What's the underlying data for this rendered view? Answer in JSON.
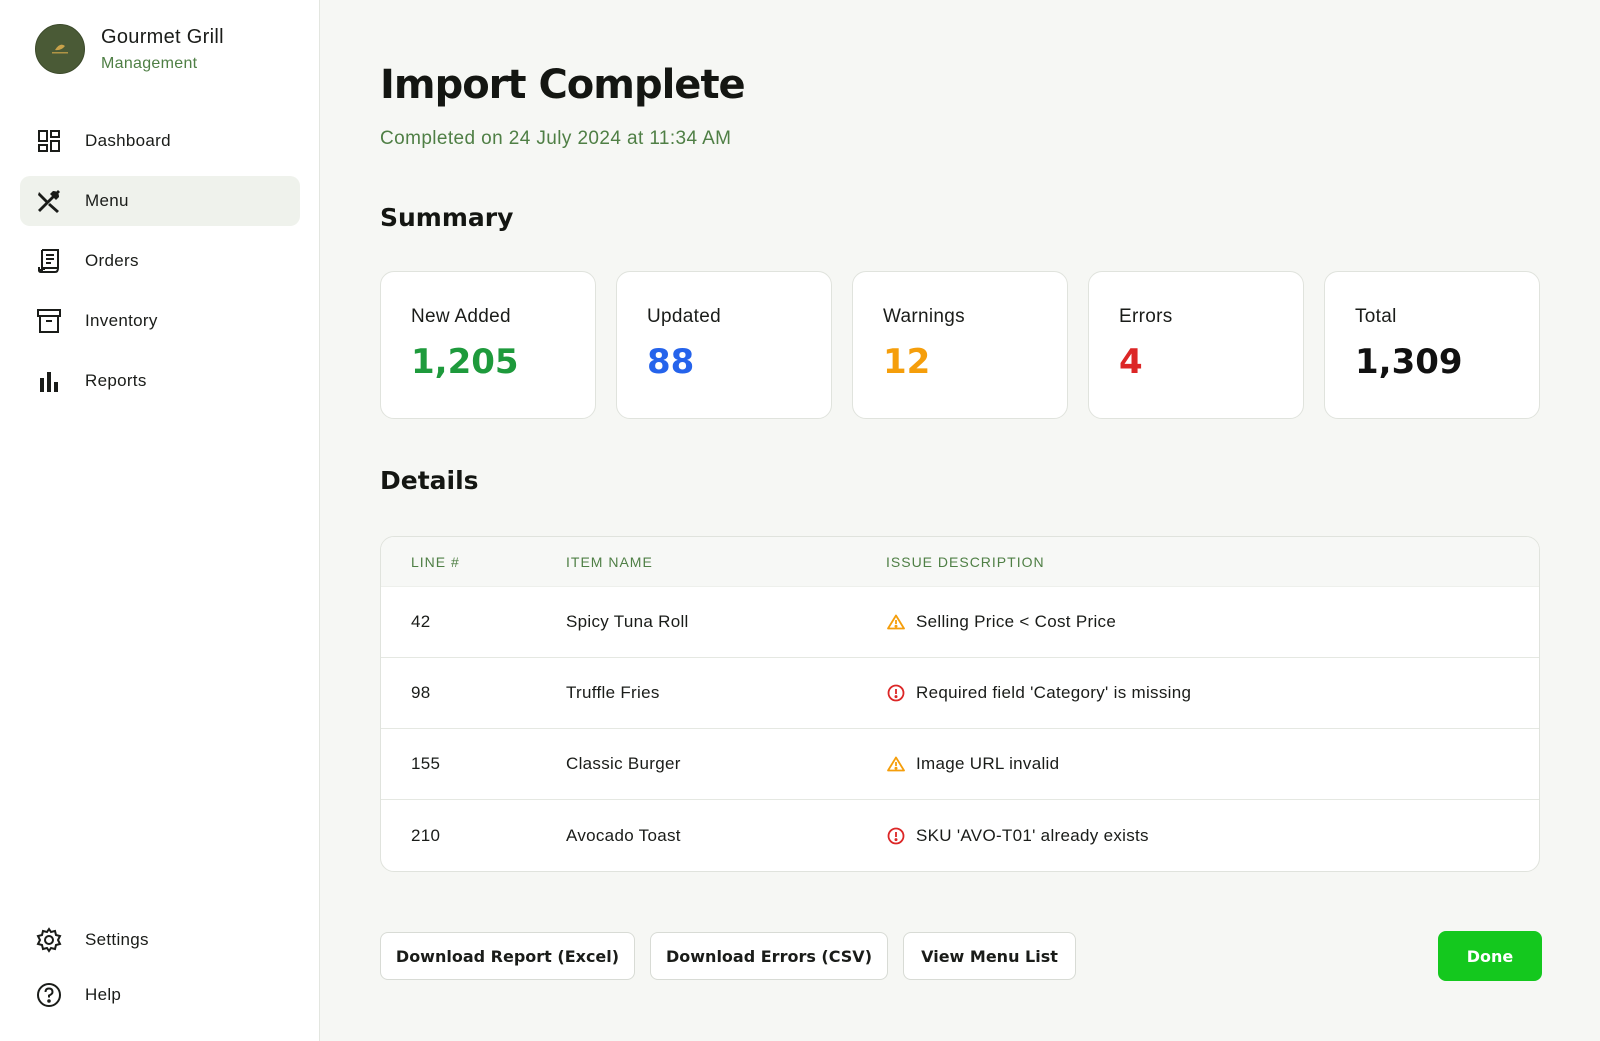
{
  "brand": {
    "name": "Gourmet Grill",
    "subtitle": "Management",
    "logo_text": "GOURMET GRILL"
  },
  "nav": {
    "items": [
      {
        "label": "Dashboard",
        "icon": "dashboard-icon"
      },
      {
        "label": "Menu",
        "icon": "utensils-icon",
        "active": true
      },
      {
        "label": "Orders",
        "icon": "receipt-icon"
      },
      {
        "label": "Inventory",
        "icon": "archive-box-icon"
      },
      {
        "label": "Reports",
        "icon": "bar-chart-icon"
      }
    ],
    "bottom": [
      {
        "label": "Settings",
        "icon": "gear-icon"
      },
      {
        "label": "Help",
        "icon": "help-circle-icon"
      }
    ]
  },
  "page": {
    "title": "Import Complete",
    "subtitle": "Completed on 24 July 2024 at 11:34 AM"
  },
  "summary": {
    "title": "Summary",
    "cards": [
      {
        "label": "New Added",
        "value": "1,205",
        "color": "#1e9a3c"
      },
      {
        "label": "Updated",
        "value": "88",
        "color": "#2563eb"
      },
      {
        "label": "Warnings",
        "value": "12",
        "color": "#f59e0b"
      },
      {
        "label": "Errors",
        "value": "4",
        "color": "#dc2626"
      },
      {
        "label": "Total",
        "value": "1,309",
        "color": "#111111"
      }
    ]
  },
  "details": {
    "title": "Details",
    "columns": [
      "LINE #",
      "ITEM NAME",
      "ISSUE DESCRIPTION"
    ],
    "rows": [
      {
        "line": "42",
        "item": "Spicy Tuna Roll",
        "issue": "Selling Price < Cost Price",
        "type": "warning",
        "icon": "warning-triangle-icon"
      },
      {
        "line": "98",
        "item": "Truffle Fries",
        "issue": "Required field 'Category' is missing",
        "type": "error",
        "icon": "error-circle-icon"
      },
      {
        "line": "155",
        "item": "Classic Burger",
        "issue": "Image URL invalid",
        "type": "warning",
        "icon": "warning-triangle-icon"
      },
      {
        "line": "210",
        "item": "Avocado Toast",
        "issue": "SKU 'AVO-T01' already exists",
        "type": "error",
        "icon": "error-circle-icon"
      }
    ]
  },
  "actions": {
    "download_report": "Download Report (Excel)",
    "download_errors": "Download Errors (CSV)",
    "view_menu": "View Menu List",
    "done": "Done"
  },
  "colors": {
    "accent_green": "#4f7f45",
    "warning": "#f59e0b",
    "error": "#dc2626",
    "primary_button": "#14c81e"
  }
}
